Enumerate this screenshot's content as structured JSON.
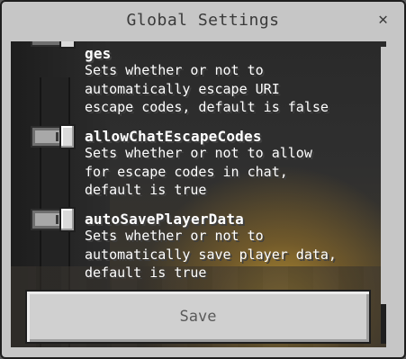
{
  "dialog": {
    "title": "Global Settings",
    "close_glyph": "✕"
  },
  "settings": [
    {
      "name": "ges",
      "description": "Sets whether or not to\nautomatically escape URI\nescape codes, default is false",
      "enabled": true
    },
    {
      "name": "allowChatEscapeCodes",
      "description": "Sets whether or not to allow\nfor escape codes in chat,\ndefault is true",
      "enabled": true
    },
    {
      "name": "autoSavePlayerData",
      "description": "Sets whether or not to\nautomatically save player data,\ndefault is true",
      "enabled": true
    }
  ],
  "save_button": {
    "label": "Save"
  },
  "icons": {
    "close": "close-icon"
  }
}
